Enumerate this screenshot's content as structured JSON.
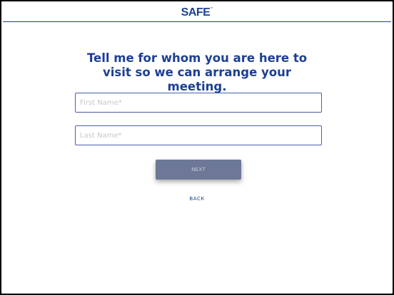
{
  "header": {
    "logo_text": "SAFE",
    "logo_mark": "™"
  },
  "form": {
    "title": "Tell me for whom you are here to visit so we can arrange your meeting.",
    "first_name": {
      "value": "",
      "placeholder": "First Name*"
    },
    "last_name": {
      "value": "",
      "placeholder": "Last Name*"
    },
    "next_label": "NEXT",
    "back_label": "BACK"
  },
  "colors": {
    "brand": "#1d3f94",
    "button": "#6c7896",
    "button_text": "#c9cfde",
    "placeholder": "#c8c8c8"
  }
}
